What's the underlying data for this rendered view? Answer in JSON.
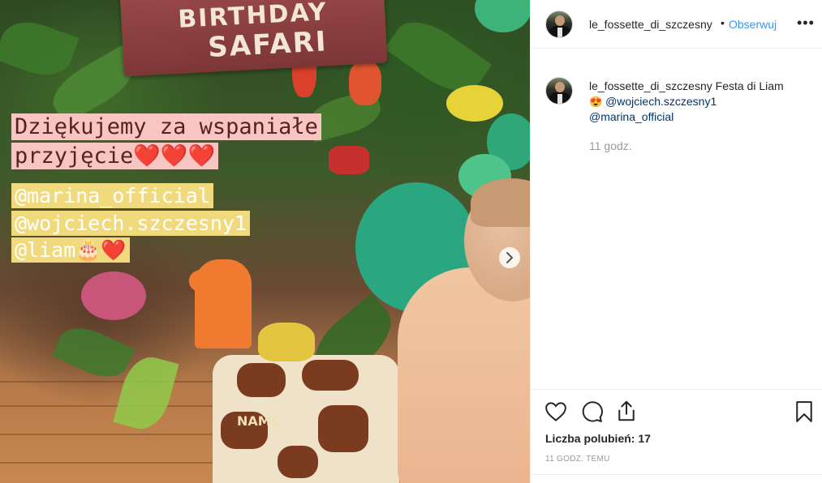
{
  "photo": {
    "sign": {
      "line1": "BIRTHDAY",
      "line2": "SAFARI"
    },
    "overlay": {
      "line1": "Dziękujemy za wspaniałe",
      "line2_text": "przyjęcie",
      "line2_hearts": "❤️❤️❤️",
      "mention1": "@marina_official",
      "mention2": "@wojciech.szczesny1",
      "mention3_text": "@liam",
      "mention3_emoji": "🎂❤️"
    },
    "cake_name": "NAME",
    "next_icon": "chevron-right-icon"
  },
  "header": {
    "username": "le_fossette_di_szczesny",
    "separator": "•",
    "follow_label": "Obserwuj",
    "more_label": "•••"
  },
  "caption": {
    "username": "le_fossette_di_szczesny",
    "text": " Festa di Liam",
    "emoji": "😍",
    "mention1": "@wojciech.szczesny1",
    "mention2": "@marina_official",
    "time": "11 godz."
  },
  "actions": {
    "icons": [
      "heart-icon",
      "comment-icon",
      "share-icon",
      "bookmark-icon"
    ],
    "likes_label": "Liczba polubień: 17",
    "timestamp": "11 GODZ. TEMU"
  },
  "colors": {
    "link": "#003569",
    "follow": "#3897f0",
    "muted": "#999999",
    "overlay_pink": "#f7c6c3",
    "overlay_yellow": "#f1da7e"
  }
}
